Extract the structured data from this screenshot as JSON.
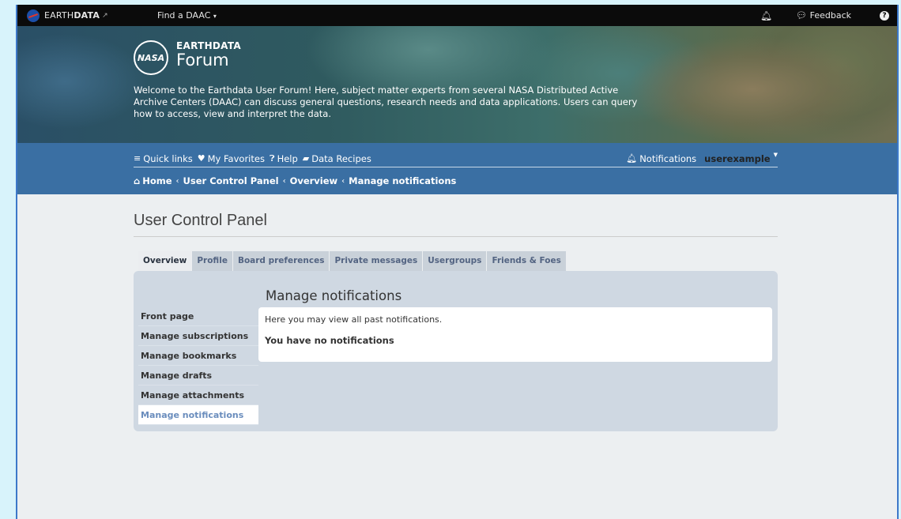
{
  "topbar": {
    "brand_prefix": "EARTH",
    "brand_bold": "DATA",
    "find_daac": "Find a DAAC",
    "feedback": "Feedback"
  },
  "hero": {
    "logo_nasa": "NASA",
    "logo_title": "EARTHDATA",
    "logo_subtitle": "Forum",
    "welcome": "Welcome to the Earthdata User Forum! Here, subject matter experts from several NASA Distributed Active Archive Centers (DAAC) can discuss general questions, research needs and data applications. Users can query how to access, view and interpret the data."
  },
  "nav": {
    "quick_links": "Quick links",
    "my_favorites": "My Favorites",
    "help": "Help",
    "data_recipes": "Data Recipes",
    "notifications": "Notifications",
    "username": "userexample"
  },
  "breadcrumbs": [
    "Home",
    "User Control Panel",
    "Overview",
    "Manage notifications"
  ],
  "page": {
    "title": "User Control Panel",
    "tabs": [
      "Overview",
      "Profile",
      "Board preferences",
      "Private messages",
      "Usergroups",
      "Friends & Foes"
    ],
    "active_tab": "Overview",
    "sidebar": [
      "Front page",
      "Manage subscriptions",
      "Manage bookmarks",
      "Manage drafts",
      "Manage attachments",
      "Manage notifications"
    ],
    "active_sidebar": "Manage notifications",
    "content_title": "Manage notifications",
    "content_intro": "Here you may view all past notifications.",
    "content_empty": "You have no notifications"
  },
  "colors": {
    "nav_band": "#3a6fa3",
    "topbar": "#0b0b0b",
    "panel": "#cfd8e2",
    "active_link": "#6a8dbd"
  }
}
